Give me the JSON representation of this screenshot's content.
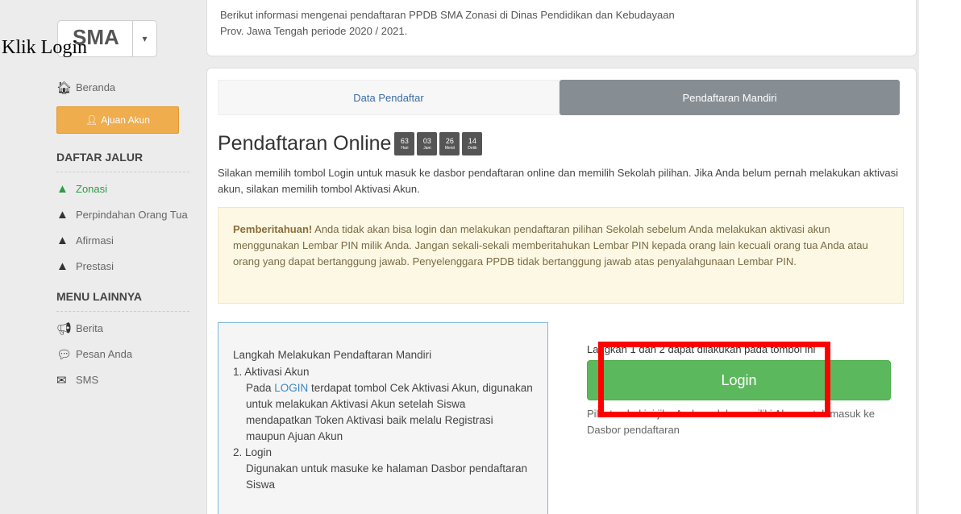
{
  "overlay_caption": "Klik Login",
  "level_select": {
    "value": "SMA",
    "caret": "▾"
  },
  "sidebar": {
    "home": {
      "icon": "home-icon",
      "label": "Beranda"
    },
    "ajuan_button": {
      "icon": "user-plus-icon",
      "label": "Ajuan Akun"
    },
    "jalur_title": "DAFTAR JALUR",
    "jalur_items": [
      {
        "label": "Zonasi",
        "active": true
      },
      {
        "label": "Perpindahan Orang Tua",
        "active": false
      },
      {
        "label": "Afirmasi",
        "active": false
      },
      {
        "label": "Prestasi",
        "active": false
      }
    ],
    "lainnya_title": "MENU LAINNYA",
    "lainnya_items": [
      {
        "icon": "megaphone-icon",
        "label": "Berita"
      },
      {
        "icon": "chat-bubble-icon",
        "label": "Pesan Anda"
      },
      {
        "icon": "envelope-icon",
        "label": "SMS"
      }
    ]
  },
  "top_info": "Berikut informasi mengenai pendaftaran PPDB SMA Zonasi di Dinas Pendidikan dan Kebudayaan Prov. Jawa Tengah periode 2020 / 2021.",
  "tabs": {
    "data_pendaftar": "Data Pendaftar",
    "pendaftaran_mandiri": "Pendaftaran Mandiri"
  },
  "heading": "Pendaftaran Online",
  "countdown": [
    {
      "value": "63",
      "unit": "Hari"
    },
    {
      "value": "03",
      "unit": "Jam"
    },
    {
      "value": "26",
      "unit": "Menit"
    },
    {
      "value": "14",
      "unit": "Detik"
    }
  ],
  "intro": "Silakan memilih tombol Login untuk masuk ke dasbor pendaftaran online dan memilih Sekolah pilihan. Jika Anda belum pernah melakukan aktivasi akun, silakan memilih tombol Aktivasi Akun.",
  "notice": {
    "title": "Pemberitahuan!",
    "text": " Anda tidak akan bisa login dan melakukan pendaftaran pilihan Sekolah sebelum Anda melakukan aktivasi akun menggunakan Lembar PIN milik Anda. Jangan sekali-sekali memberitahukan Lembar PIN kepada orang lain kecuali orang tua Anda atau orang yang dapat bertanggung jawab. Penyelenggara PPDB tidak bertanggung jawab atas penyalahgunaan Lembar PIN."
  },
  "steps": {
    "title": "Langkah Melakukan Pendaftaran Mandiri",
    "step1_head": "1. Aktivasi Akun",
    "step1_pre": "Pada ",
    "step1_link": "LOGIN",
    "step1_post": " terdapat tombol Cek Aktivasi Akun, digunakan untuk melakukan Aktivasi Akun setelah Siswa mendapatkan Token Aktivasi baik melalu Registrasi maupun Ajuan Akun",
    "step2_head": "2. Login",
    "step2_body": "Digunakan untuk masuke ke halaman Dasbor pendaftaran Siswa"
  },
  "login": {
    "hint": "Langkah 1 dan 2 dapat dilakukan pada tombol ini",
    "button": "Login",
    "desc": "Pilih tombol ini jika Anda sudah memiliki Akun untuk masuk ke Dasbor pendaftaran"
  },
  "colors": {
    "green": "#5cb85c",
    "orange": "#f0ad4e",
    "highlight": "#ff0000",
    "tab_active": "#868e94"
  }
}
